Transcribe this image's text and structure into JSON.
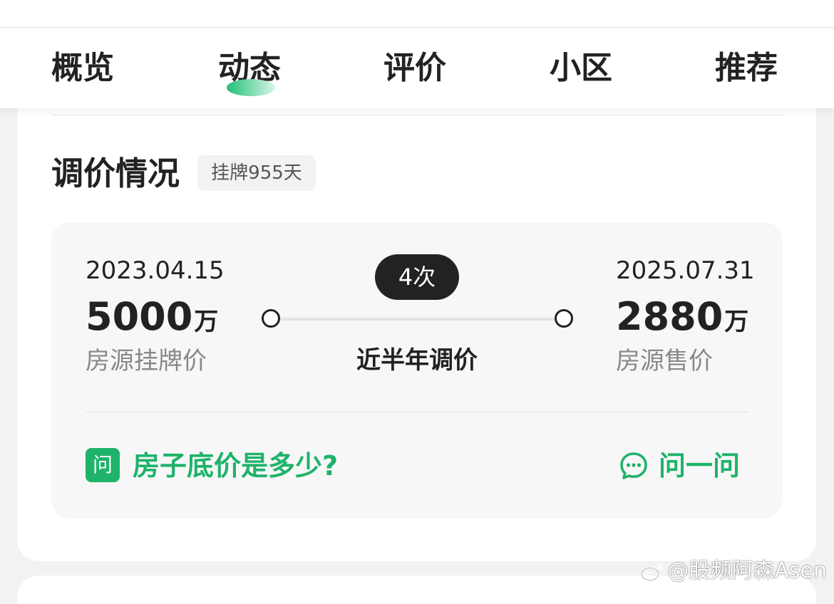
{
  "tabs": [
    {
      "label": "概览"
    },
    {
      "label": "动态"
    },
    {
      "label": "评价"
    },
    {
      "label": "小区"
    },
    {
      "label": "推荐"
    }
  ],
  "section": {
    "title": "调价情况",
    "badge": "挂牌955天"
  },
  "price_change": {
    "start": {
      "date": "2023.04.15",
      "price": "5000",
      "unit": "万",
      "label": "房源挂牌价"
    },
    "end": {
      "date": "2025.07.31",
      "price": "2880",
      "unit": "万",
      "label": "房源售价"
    },
    "count": "4次",
    "middle_label": "近半年调价"
  },
  "ask": {
    "badge": "问",
    "question": "房子底价是多少?",
    "link_label": "问一问",
    "link_icon": "chat-bubble-icon",
    "accent_color": "#1fb36a"
  },
  "watermark": {
    "text": "@股频阿森Asen",
    "icon": "weibo-icon"
  }
}
